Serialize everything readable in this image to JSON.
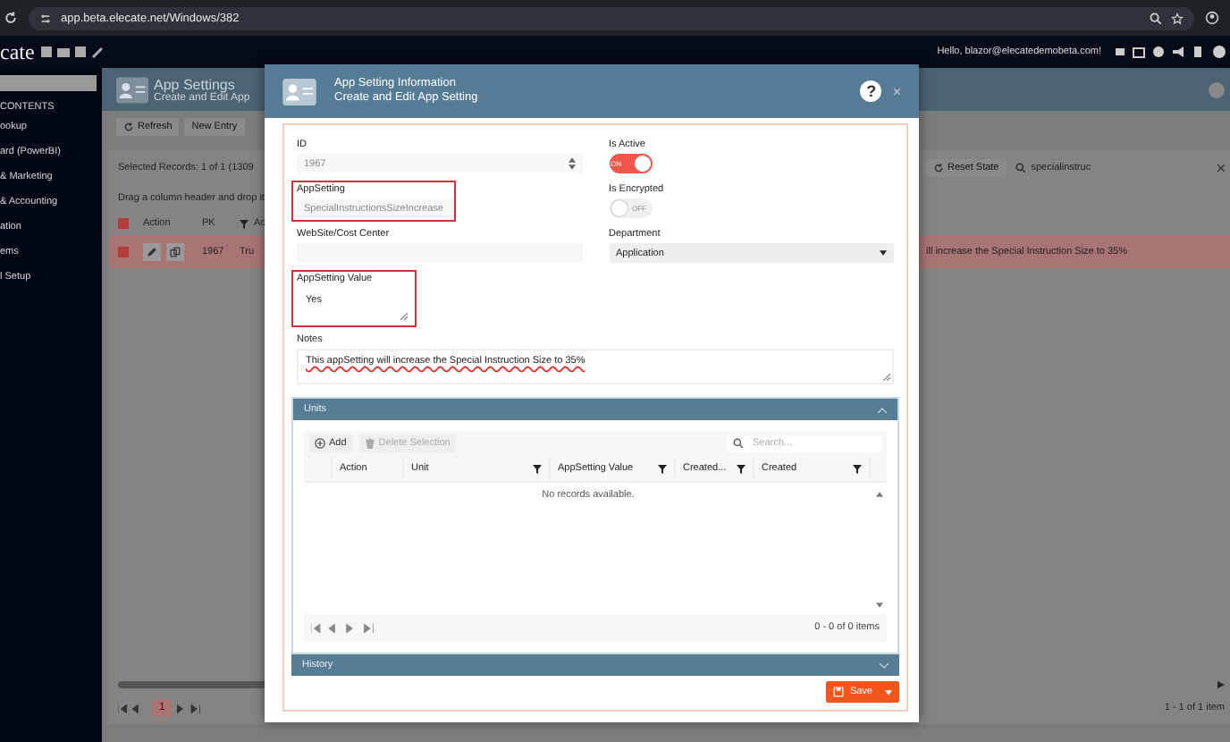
{
  "browser": {
    "url": "app.beta.elecate.net/Windows/382"
  },
  "app_header": {
    "logo": "cate",
    "greeting": "Hello, blazor@elecatedemobeta.com!"
  },
  "sidebar": {
    "heading": "CONTENTS",
    "items": [
      "ookup",
      "ard (PowerBI)",
      "& Marketing",
      "& Accounting",
      "ation",
      "ems",
      "l Setup"
    ]
  },
  "page": {
    "title": "App Settings",
    "subtitle": "Create and Edit App",
    "toolbar": [
      "Refresh",
      "New Entry"
    ],
    "selected_records": "Selected Records: 1 of 1 (1309",
    "reset_state": "Reset State",
    "search_value": "specialinstruc",
    "group_hint": "Drag a column header and drop it",
    "columns": [
      "Action",
      "PK",
      "Ac"
    ],
    "row": {
      "selected": true,
      "pk": "1967",
      "cell": "Tru",
      "notes_tail": "ill increase the Special Instruction Size to 35%"
    },
    "pager": {
      "page": "1",
      "summary": "1 - 1 of 1 item"
    }
  },
  "dialog": {
    "title": "App Setting Information",
    "subtitle": "Create and Edit App Setting",
    "help": "?",
    "close": "×",
    "fields": [
      {
        "kind": "number",
        "label": "ID",
        "value": "1967",
        "disabled": true,
        "highlighted": false
      },
      {
        "kind": "toggle",
        "label": "Is Active",
        "on": true,
        "state_label": "ON",
        "highlighted": false
      },
      {
        "kind": "input",
        "label": "AppSetting",
        "value": "SpecialInstructionsSizeIncrease",
        "disabled": true,
        "highlighted": true
      },
      {
        "kind": "toggle",
        "label": "Is Encrypted",
        "on": false,
        "state_label": "OFF",
        "highlighted": false
      },
      {
        "kind": "input",
        "label": "WebSite/Cost Center",
        "highlighted": false
      },
      {
        "kind": "select",
        "label": "Department",
        "value": "Application",
        "highlighted": false
      },
      {
        "kind": "textarea",
        "label": "AppSetting Value",
        "value": "Yes",
        "highlighted": true
      },
      {
        "kind": "textarea",
        "label": "Notes",
        "value": "This appSetting will increase the Special Instruction Size to 35%",
        "highlighted": false
      }
    ],
    "units": {
      "title": "Units",
      "expanded": true,
      "buttons": [
        {
          "label": "Add",
          "disabled": false
        },
        {
          "label": "Delete Selection",
          "disabled": true
        }
      ],
      "search_placeholder": "Search...",
      "columns": [
        {
          "label": "Action",
          "filter": false
        },
        {
          "label": "Unit",
          "filter": true
        },
        {
          "label": "AppSetting Value",
          "filter": true
        },
        {
          "label": "Created...",
          "filter": true
        },
        {
          "label": "Created",
          "filter": true
        }
      ],
      "empty": "No records available.",
      "summary": "0 - 0 of 0 items"
    },
    "history": {
      "title": "History",
      "expanded": false
    },
    "save": "Save"
  }
}
